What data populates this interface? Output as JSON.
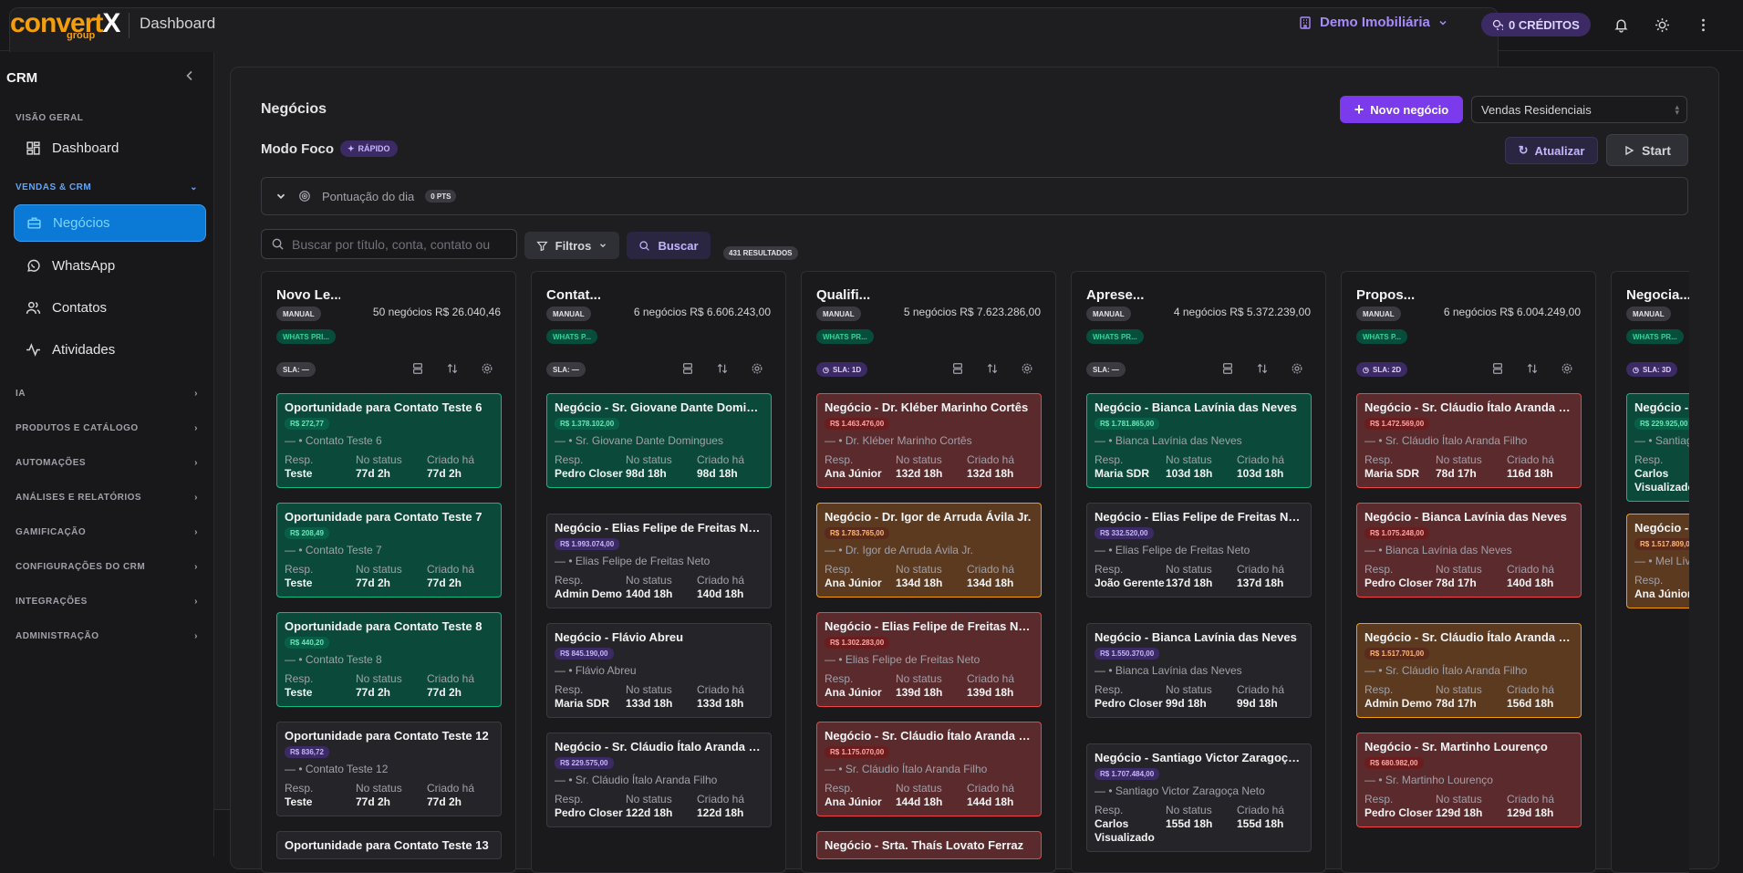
{
  "topbar": {
    "logo_main_a": "convert",
    "logo_main_b": "X",
    "logo_sub": "group",
    "title": "Dashboard",
    "company": "Demo Imobiliária",
    "credits": "0 CRÉDITOS"
  },
  "sidebar": {
    "header": "CRM",
    "sections": {
      "overview": "VISÃO GERAL",
      "sales": "VENDAS & CRM",
      "ia": "IA",
      "products": "PRODUTOS E CATÁLOGO",
      "automations": "AUTOMAÇÕES",
      "analytics": "ANÁLISES E RELATÓRIOS",
      "gamification": "GAMIFICAÇÃO",
      "crm_settings": "CONFIGURAÇÕES DO CRM",
      "integrations": "INTEGRAÇÕES",
      "admin": "ADMINISTRAÇÃO"
    },
    "items": {
      "dashboard": "Dashboard",
      "negocios": "Negócios",
      "whatsapp": "WhatsApp",
      "contatos": "Contatos",
      "atividades": "Atividades"
    }
  },
  "page": {
    "title": "Negócios",
    "new_button": "Novo negócio",
    "pipeline_select": "Vendas Residenciais",
    "focus_mode": "Modo Foco",
    "focus_badge": "RÁPIDO",
    "refresh_button": "Atualizar",
    "start_button": "Start",
    "score_label": "Pontuação do dia",
    "score_badge": "0 PTS",
    "search_placeholder": "Buscar por título, conta, contato ou",
    "filters_button": "Filtros",
    "search_button": "Buscar",
    "results": "431 RESULTADOS"
  },
  "labels": {
    "resp": "Resp.",
    "status": "No status",
    "created": "Criado há"
  },
  "colors": {
    "accent": "#7c3aed",
    "sidebar_active": "#0a7ad6",
    "card_green": "#10b981",
    "card_red": "#ef4444",
    "card_orange": "#f59e0b"
  },
  "columns": [
    {
      "title": "Novo Le...",
      "meta": "50 negócios R$ 26.040,46",
      "mode": "MANUAL",
      "channel": "WHATS PRI...",
      "sla": "SLA: —",
      "cards": [
        {
          "title": "Oportunidade para Contato Teste 6",
          "value": "R$ 272,77",
          "contact": "— • Contato Teste 6",
          "resp": "Teste",
          "status": "77d 2h",
          "created": "77d 2h",
          "color": "green"
        },
        {
          "title": "Oportunidade para Contato Teste 7",
          "value": "R$ 208,49",
          "contact": "— • Contato Teste 7",
          "resp": "Teste",
          "status": "77d 2h",
          "created": "77d 2h",
          "color": "green"
        },
        {
          "title": "Oportunidade para Contato Teste 8",
          "value": "R$ 440,20",
          "contact": "— • Contato Teste 8",
          "resp": "Teste",
          "status": "77d 2h",
          "created": "77d 2h",
          "color": "green"
        },
        {
          "title": "Oportunidade para Contato Teste 12",
          "value": "R$ 836,72",
          "contact": "— • Contato Teste 12",
          "resp": "Teste",
          "status": "77d 2h",
          "created": "77d 2h",
          "color": "neutral"
        },
        {
          "title": "Oportunidade para Contato Teste 13",
          "value": "",
          "contact": "",
          "resp": "",
          "status": "",
          "created": "",
          "color": "neutral"
        }
      ]
    },
    {
      "title": "Contat...",
      "meta": "6 negócios R$ 6.606.243,00",
      "mode": "MANUAL",
      "channel": "WHATS P...",
      "sla": "SLA: —",
      "cards": [
        {
          "title": "Negócio - Sr. Giovane Dante Domingues",
          "value": "R$ 1.378.102,00",
          "contact": "— • Sr. Giovane Dante Domingues",
          "resp": "Pedro Closer",
          "status": "98d 18h",
          "created": "98d 18h",
          "color": "green"
        },
        {
          "title": "Negócio - Elias Felipe de Freitas Neto",
          "value": "R$ 1.993.074,00",
          "contact": "— • Elias Felipe de Freitas Neto",
          "resp": "Admin Demo",
          "status": "140d 18h",
          "created": "140d 18h",
          "color": "neutral"
        },
        {
          "title": "Negócio - Flávio Abreu",
          "value": "R$ 845.190,00",
          "contact": "— • Flávio Abreu",
          "resp": "Maria SDR",
          "status": "133d 18h",
          "created": "133d 18h",
          "color": "neutral"
        },
        {
          "title": "Negócio - Sr. Cláudio Ítalo Aranda Filho",
          "value": "R$ 229.575,00",
          "contact": "— • Sr. Cláudio Ítalo Aranda Filho",
          "resp": "Pedro Closer",
          "status": "122d 18h",
          "created": "122d 18h",
          "color": "neutral"
        }
      ]
    },
    {
      "title": "Qualifi...",
      "meta": "5 negócios R$ 7.623.286,00",
      "mode": "MANUAL",
      "channel": "WHATS PR...",
      "sla": "SLA: 1D",
      "cards": [
        {
          "title": "Negócio - Dr. Kléber Marinho Cortês",
          "value": "R$ 1.463.476,00",
          "contact": "— • Dr. Kléber Marinho Cortês",
          "resp": "Ana Júnior",
          "status": "132d 18h",
          "created": "132d 18h",
          "color": "red"
        },
        {
          "title": "Negócio - Dr. Igor de Arruda Ávila Jr.",
          "value": "R$ 1.783.765,00",
          "contact": "— • Dr. Igor de Arruda Ávila Jr.",
          "resp": "Ana Júnior",
          "status": "134d 18h",
          "created": "134d 18h",
          "color": "orange"
        },
        {
          "title": "Negócio - Elias Felipe de Freitas Neto",
          "value": "R$ 1.302.283,00",
          "contact": "— • Elias Felipe de Freitas Neto",
          "resp": "Ana Júnior",
          "status": "139d 18h",
          "created": "139d 18h",
          "color": "red"
        },
        {
          "title": "Negócio - Sr. Cláudio Ítalo Aranda Filho",
          "value": "R$ 1.175.070,00",
          "contact": "— • Sr. Cláudio Ítalo Aranda Filho",
          "resp": "Ana Júnior",
          "status": "144d 18h",
          "created": "144d 18h",
          "color": "red"
        },
        {
          "title": "Negócio - Srta. Thaís Lovato Ferraz",
          "value": "",
          "contact": "",
          "resp": "",
          "status": "",
          "created": "",
          "color": "red"
        }
      ]
    },
    {
      "title": "Aprese...",
      "meta": "4 negócios R$ 5.372.239,00",
      "mode": "MANUAL",
      "channel": "WHATS PR...",
      "sla": "SLA: —",
      "cards": [
        {
          "title": "Negócio - Bianca Lavínia das Neves",
          "value": "R$ 1.781.865,00",
          "contact": "— • Bianca Lavínia das Neves",
          "resp": "Maria SDR",
          "status": "103d 18h",
          "created": "103d 18h",
          "color": "green"
        },
        {
          "title": "Negócio - Elias Felipe de Freitas Neto",
          "value": "R$ 332.520,00",
          "contact": "— • Elias Felipe de Freitas Neto",
          "resp": "João Gerente",
          "status": "137d 18h",
          "created": "137d 18h",
          "color": "neutral"
        },
        {
          "title": "Negócio - Bianca Lavínia das Neves",
          "value": "R$ 1.550.370,00",
          "contact": "— • Bianca Lavínia das Neves",
          "resp": "Pedro Closer",
          "status": "99d 18h",
          "created": "99d 18h",
          "color": "neutral"
        },
        {
          "title": "Negócio - Santiago Victor Zaragoça Neto",
          "value": "R$ 1.707.484,00",
          "contact": "— • Santiago Victor Zaragoça Neto",
          "resp": "Carlos Visualizado",
          "status": "155d 18h",
          "created": "155d 18h",
          "color": "neutral"
        }
      ]
    },
    {
      "title": "Propos...",
      "meta": "6 negócios R$ 6.004.249,00",
      "mode": "MANUAL",
      "channel": "WHATS P...",
      "sla": "SLA: 2D",
      "cards": [
        {
          "title": "Negócio - Sr. Cláudio Ítalo Aranda Filho",
          "value": "R$ 1.472.569,00",
          "contact": "— • Sr. Cláudio Ítalo Aranda Filho",
          "resp": "Maria SDR",
          "status": "78d 17h",
          "created": "116d 18h",
          "color": "red"
        },
        {
          "title": "Negócio - Bianca Lavínia das Neves",
          "value": "R$ 1.075.248,00",
          "contact": "— • Bianca Lavínia das Neves",
          "resp": "Pedro Closer",
          "status": "78d 17h",
          "created": "140d 18h",
          "color": "red"
        },
        {
          "title": "Negócio - Sr. Cláudio Ítalo Aranda Filho",
          "value": "R$ 1.517.701,00",
          "contact": "— • Sr. Cláudio Ítalo Aranda Filho",
          "resp": "Admin Demo",
          "status": "78d 17h",
          "created": "156d 18h",
          "color": "orange"
        },
        {
          "title": "Negócio - Sr. Martinho Lourenço",
          "value": "R$ 680.982,00",
          "contact": "— • Sr. Martinho Lourenço",
          "resp": "Pedro Closer",
          "status": "129d 18h",
          "created": "129d 18h",
          "color": "red"
        }
      ]
    },
    {
      "title": "Negocia...",
      "meta": "",
      "mode": "MANUAL",
      "channel": "WHATS PR...",
      "sla": "SLA: 3D",
      "cards": [
        {
          "title": "Negócio - Sr. Cláudio",
          "value": "R$ 229.925,00",
          "contact": "— • Santiago",
          "resp": "Carlos Visualizador",
          "status": "",
          "created": "",
          "color": "green"
        },
        {
          "title": "Negócio - Mel Lívia",
          "value": "R$ 1.517.809,00",
          "contact": "— • Mel Lívia",
          "resp": "Ana Júnior",
          "status": "",
          "created": "",
          "color": "orange"
        }
      ]
    }
  ]
}
